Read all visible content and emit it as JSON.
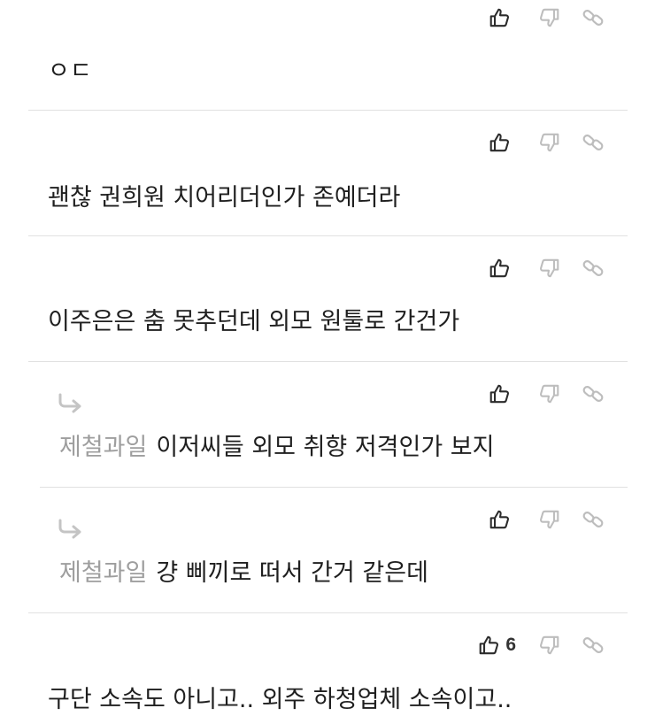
{
  "comments": [
    {
      "text": "ㅇㄷ",
      "likes": ""
    },
    {
      "text": "괜찮 권희원 치어리더인가 존예더라",
      "likes": ""
    },
    {
      "text": "이주은은 춤 못추던데 외모 원툴로 간건가",
      "likes": ""
    },
    {
      "nick": "제철과일",
      "text": "이저씨들 외모 취향 저격인가 보지",
      "likes": ""
    },
    {
      "nick": "제철과일",
      "text": "걍 삐끼로 떠서 간거 같은데",
      "likes": ""
    },
    {
      "text": "구단 소속도 아니고.. 외주 하청업체 소속이고..",
      "likes": "6"
    }
  ],
  "icons": {
    "like": "thumbs-up-icon",
    "dislike": "thumbs-down-icon",
    "link": "link-icon",
    "reply": "reply-arrow-icon"
  },
  "colors": {
    "icon_dark": "#2b2b2b",
    "icon_light": "#bdbdbd",
    "nick": "#9e9e9e",
    "divider": "#e1e1e1"
  }
}
